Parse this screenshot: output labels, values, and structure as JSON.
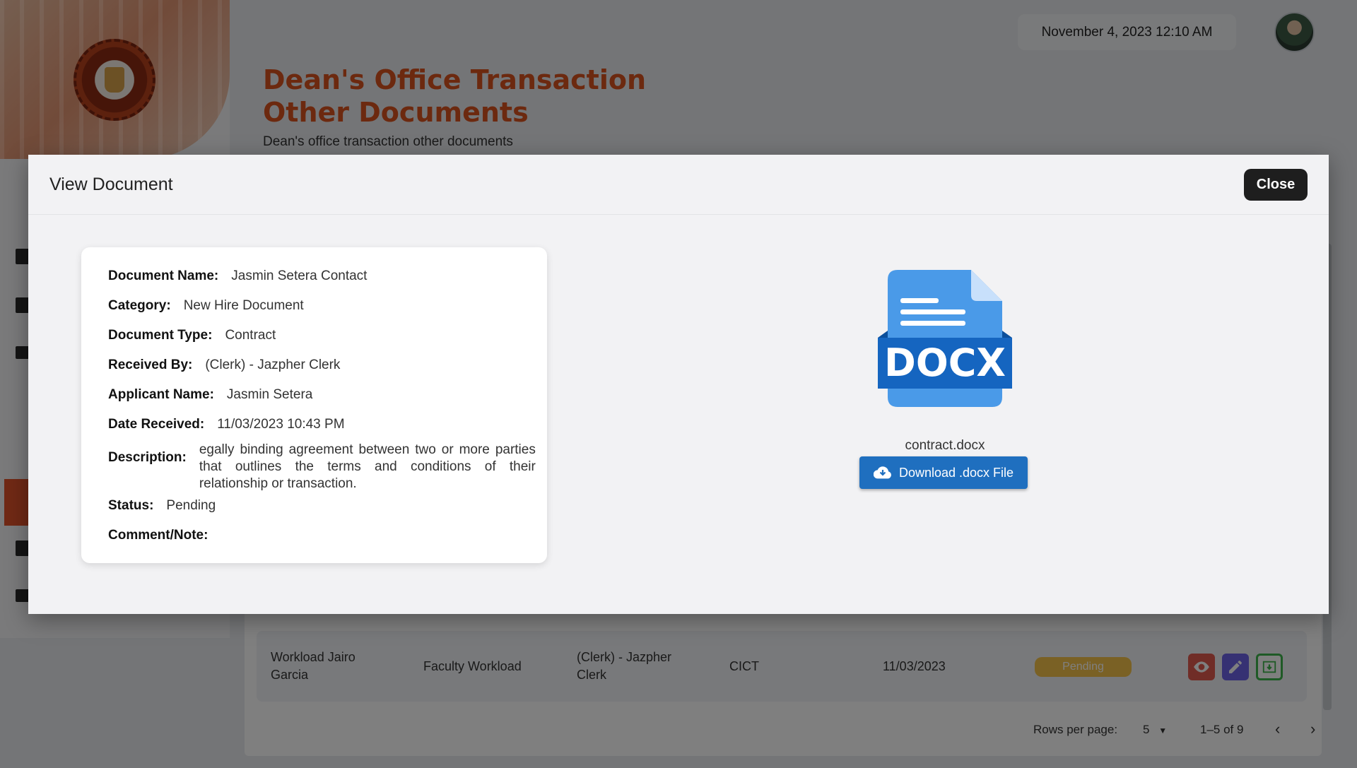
{
  "header": {
    "title_line1": "Dean's Office Transaction",
    "title_line2": "Other Documents",
    "subtitle": "Dean's office transaction other documents",
    "datetime": "November 4, 2023 12:10 AM"
  },
  "table": {
    "row": {
      "document_name": "Workload Jairo Garcia",
      "category": "Faculty Workload",
      "received_by": "(Clerk) - Jazpher Clerk",
      "department": "CICT",
      "date": "11/03/2023",
      "status": "Pending"
    },
    "footer": {
      "rows_per_page_label": "Rows per page:",
      "rows_per_page_value": "5",
      "range": "1–5 of 9"
    }
  },
  "modal": {
    "title": "View Document",
    "close_label": "Close",
    "fields": {
      "document_name_label": "Document Name:",
      "document_name": "Jasmin Setera Contact",
      "category_label": "Category:",
      "category": "New Hire Document",
      "document_type_label": "Document Type:",
      "document_type": "Contract",
      "received_by_label": "Received By:",
      "received_by": "(Clerk) - Jazpher Clerk",
      "applicant_name_label": "Applicant Name:",
      "applicant_name": "Jasmin Setera",
      "date_received_label": "Date Received:",
      "date_received": "11/03/2023 10:43 PM",
      "description_label": "Description:",
      "description": "egally binding agreement between two or more parties that outlines the terms and conditions of their relationship or transaction.",
      "status_label": "Status:",
      "status": "Pending",
      "comment_label": "Comment/Note:",
      "comment": ""
    },
    "file": {
      "icon_text": "DOCX",
      "filename": "contract.docx",
      "download_label": "Download .docx File"
    }
  },
  "colors": {
    "brand_orange": "#d9521e",
    "docx_blue": "#1f6fbf",
    "pending": "#f5c24a"
  }
}
